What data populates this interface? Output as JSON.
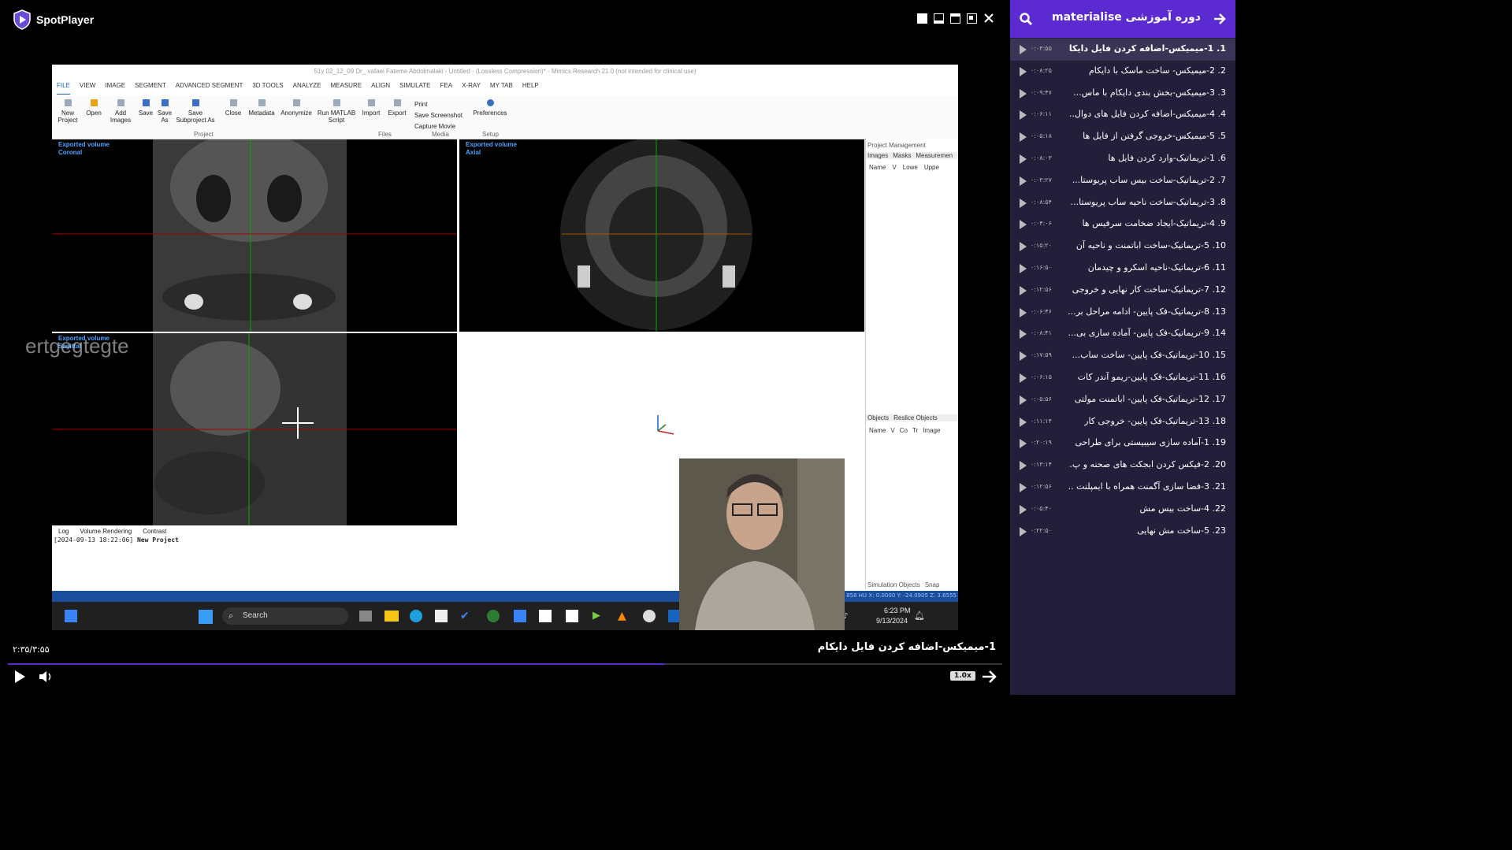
{
  "app": {
    "name": "SpotPlayer"
  },
  "window_controls": [
    "restore-icon",
    "minimize-icon",
    "maximize-icon",
    "tile-icon",
    "close-icon"
  ],
  "video": {
    "mimics_title": "51y 02_12_09 Dr_ vafaei Fateme Abdolmalaki - Untitled - (Lossless Compression)* - Mimics Research 21.0 (not intended for clinical use)",
    "menu": [
      "FILE",
      "VIEW",
      "IMAGE",
      "SEGMENT",
      "ADVANCED SEGMENT",
      "3D TOOLS",
      "ANALYZE",
      "MEASURE",
      "ALIGN",
      "SIMULATE",
      "FEA",
      "X-RAY",
      "MY TAB",
      "HELP"
    ],
    "ribbon": {
      "buttons": [
        "New Project",
        "Open",
        "Add Images",
        "Save",
        "Save As",
        "Save Subproject As",
        "Close",
        "Metadata",
        "Anonymize",
        "Run MATLAB Script",
        "Import",
        "Export",
        "Preferences"
      ],
      "media": [
        "Print",
        "Save Screenshot",
        "Capture Movie"
      ],
      "groups": [
        "Project",
        "Files",
        "Media",
        "Setup"
      ]
    },
    "viewports": {
      "coronal": {
        "line1": "Exported volume",
        "line2": "Coronal"
      },
      "axial": {
        "line1": "Exported volume",
        "line2": "Axial"
      },
      "sagittal": {
        "line1": "Exported volume",
        "line2": "Sagittal"
      }
    },
    "project_management": {
      "title": "Project Management",
      "tabs": [
        "Images",
        "Masks",
        "Measuremen"
      ],
      "cols": [
        "Name",
        "V",
        "Lowe",
        "Uppe"
      ],
      "objects_tabs": [
        "Objects",
        "Reslice Objects"
      ],
      "objects_cols": [
        "Name",
        "V",
        "Co",
        "Tr",
        "Image"
      ],
      "bottom_tabs": [
        "Simulation Objects",
        "Snap"
      ]
    },
    "log_tabs": [
      "Log",
      "Volume Rendering",
      "Contrast"
    ],
    "log_line_time": "[2024-09-13 18:22:06]",
    "log_line_text": "New Project",
    "status_text": "858 HU X: 0.0000 Y: -24.0905 Z: 3.6555",
    "taskbar": {
      "search": "Search",
      "time": "6:23 PM",
      "date": "9/13/2024"
    },
    "watermark": "ertgegtegte"
  },
  "playlist": {
    "header": "دوره آموزشی  materialise",
    "items": [
      {
        "title": "1. 1-میمیکس-اضافه کردن فایل دایکام",
        "duration": "۰:۰۳:۵۵",
        "active": true
      },
      {
        "title": "2. 2-میمیکس- ساخت ماسک با دایکام",
        "duration": "۰:۰۸:۲۵"
      },
      {
        "title": "3. 3-میمیکس-بخش بندی دایکام با ماس...",
        "duration": "۰:۰۹:۴۷"
      },
      {
        "title": "4. 4-میمیکس-اضافه کردن فایل های دوال...",
        "duration": "۰:۰۶:۱۱"
      },
      {
        "title": "5. 5-میمیکس-خروجی گرفتن از فایل ها",
        "duration": "۰:۰۵:۱۸"
      },
      {
        "title": "6. 1-تریماتیک-وارد کردن فایل ها",
        "duration": "۰:۰۸:۰۳"
      },
      {
        "title": "7. 2-تریماتیک-ساخت بیس ساب پریوستا...",
        "duration": "۰:۰۳:۲۷"
      },
      {
        "title": "8. 3-تریماتیک-ساخت ناحیه ساب پریوستا...",
        "duration": "۰:۰۸:۵۴"
      },
      {
        "title": "9. 4-تریماتیک-ایجاد ضخامت سرفیس ها",
        "duration": "۰:۰۴:۰۶"
      },
      {
        "title": "10. 5-تریماتیک-ساخت اباتمنت و ناحیه آن",
        "duration": "۰:۱۵:۲۰"
      },
      {
        "title": "11. 6-تریماتیک-ناحیه اسکرو و چیدمان",
        "duration": "۰:۱۶:۵۰"
      },
      {
        "title": "12. 7-تریماتیک-ساخت کار نهایی و خروجی",
        "duration": "۰:۱۲:۵۶"
      },
      {
        "title": "13. 8-تریماتیک-فک پایین- ادامه مراحل بر...",
        "duration": "۰:۰۶:۴۶"
      },
      {
        "title": "14. 9-تریماتیک-فک پایین- آماده سازی بی...",
        "duration": "۰:۰۸:۴۱"
      },
      {
        "title": "15. 10-تریماتیک-فک پایین- ساخت ساب...",
        "duration": "۰:۱۷:۵۹"
      },
      {
        "title": "16. 11-تریماتیک-فک پایین-ریمو آندر کات",
        "duration": "۰:۰۶:۱۵"
      },
      {
        "title": "17. 12-تریماتیک-فک پایین- اباتمنت مولتی",
        "duration": "۰:۰۵:۵۶"
      },
      {
        "title": "18. 13-تریماتیک-فک پایین- خروجی کار",
        "duration": "۰:۱۱:۱۴"
      },
      {
        "title": "19. 1-آماده سازی سیبیستی برای طراحی",
        "duration": "۰:۲۰:۱۹"
      },
      {
        "title": "20. 2-فیکس کردن ابجکت های صحنه و پ...",
        "duration": "۰:۱۳:۱۴"
      },
      {
        "title": "21. 3-فضا سازی آگمنت همراه با ایمپلنت ...",
        "duration": "۰:۱۲:۵۶"
      },
      {
        "title": "22. 4-ساخت بیس مش",
        "duration": "۰:۰۵:۴۰"
      },
      {
        "title": "23. 5-ساخت مش نهایی",
        "duration": "۰:۲۲:۵۰"
      }
    ]
  },
  "player": {
    "time": "۲:۳۵/۳:۵۵",
    "now_playing": "1-میمیکس-اضافه کردن فایل دایکام",
    "progress_fraction": 0.66,
    "speed": "1.0x"
  },
  "colors": {
    "accent": "#5b2bd1",
    "sidebar_bg": "#231f3b",
    "active_item": "#3a3557"
  }
}
